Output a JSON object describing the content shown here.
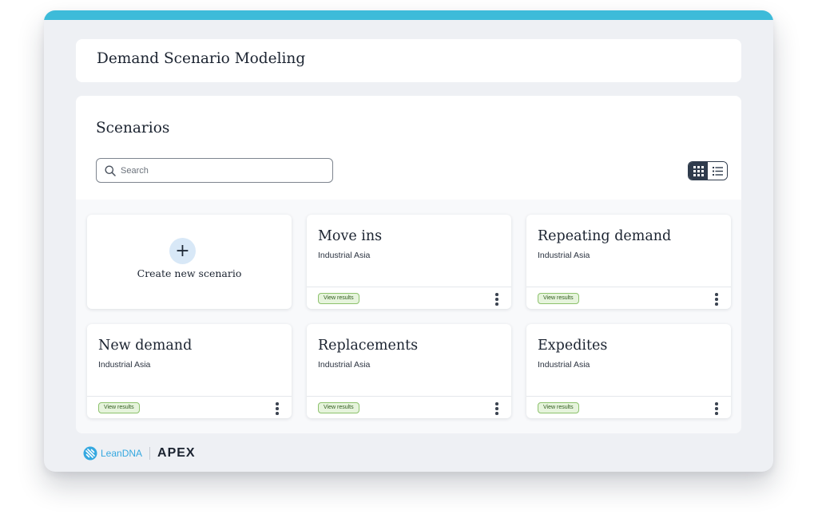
{
  "app": {
    "title": "Demand Scenario Modeling"
  },
  "scenarios": {
    "heading": "Scenarios",
    "search_placeholder": "Search",
    "view_modes": [
      "grid-view-icon",
      "list-view-icon"
    ],
    "create_label": "Create new scenario",
    "create_icon": "+",
    "cards": [
      {
        "title": "Move ins",
        "subtitle": "Industrial Asia",
        "action": "View results"
      },
      {
        "title": "Repeating demand",
        "subtitle": "Industrial Asia",
        "action": "View results"
      },
      {
        "title": "New demand",
        "subtitle": "Industrial Asia",
        "action": "View results"
      },
      {
        "title": "Replacements",
        "subtitle": "Industrial Asia",
        "action": "View results"
      },
      {
        "title": "Expedites",
        "subtitle": "Industrial Asia",
        "action": "View results"
      }
    ]
  },
  "footer": {
    "brand": "LeanDNA",
    "product": "APEX"
  },
  "colors": {
    "accent": "#3dbbd9",
    "badge_bg": "#e6f4dc",
    "badge_border": "#8dc26d",
    "toggle_active": "#2f3b4c"
  }
}
